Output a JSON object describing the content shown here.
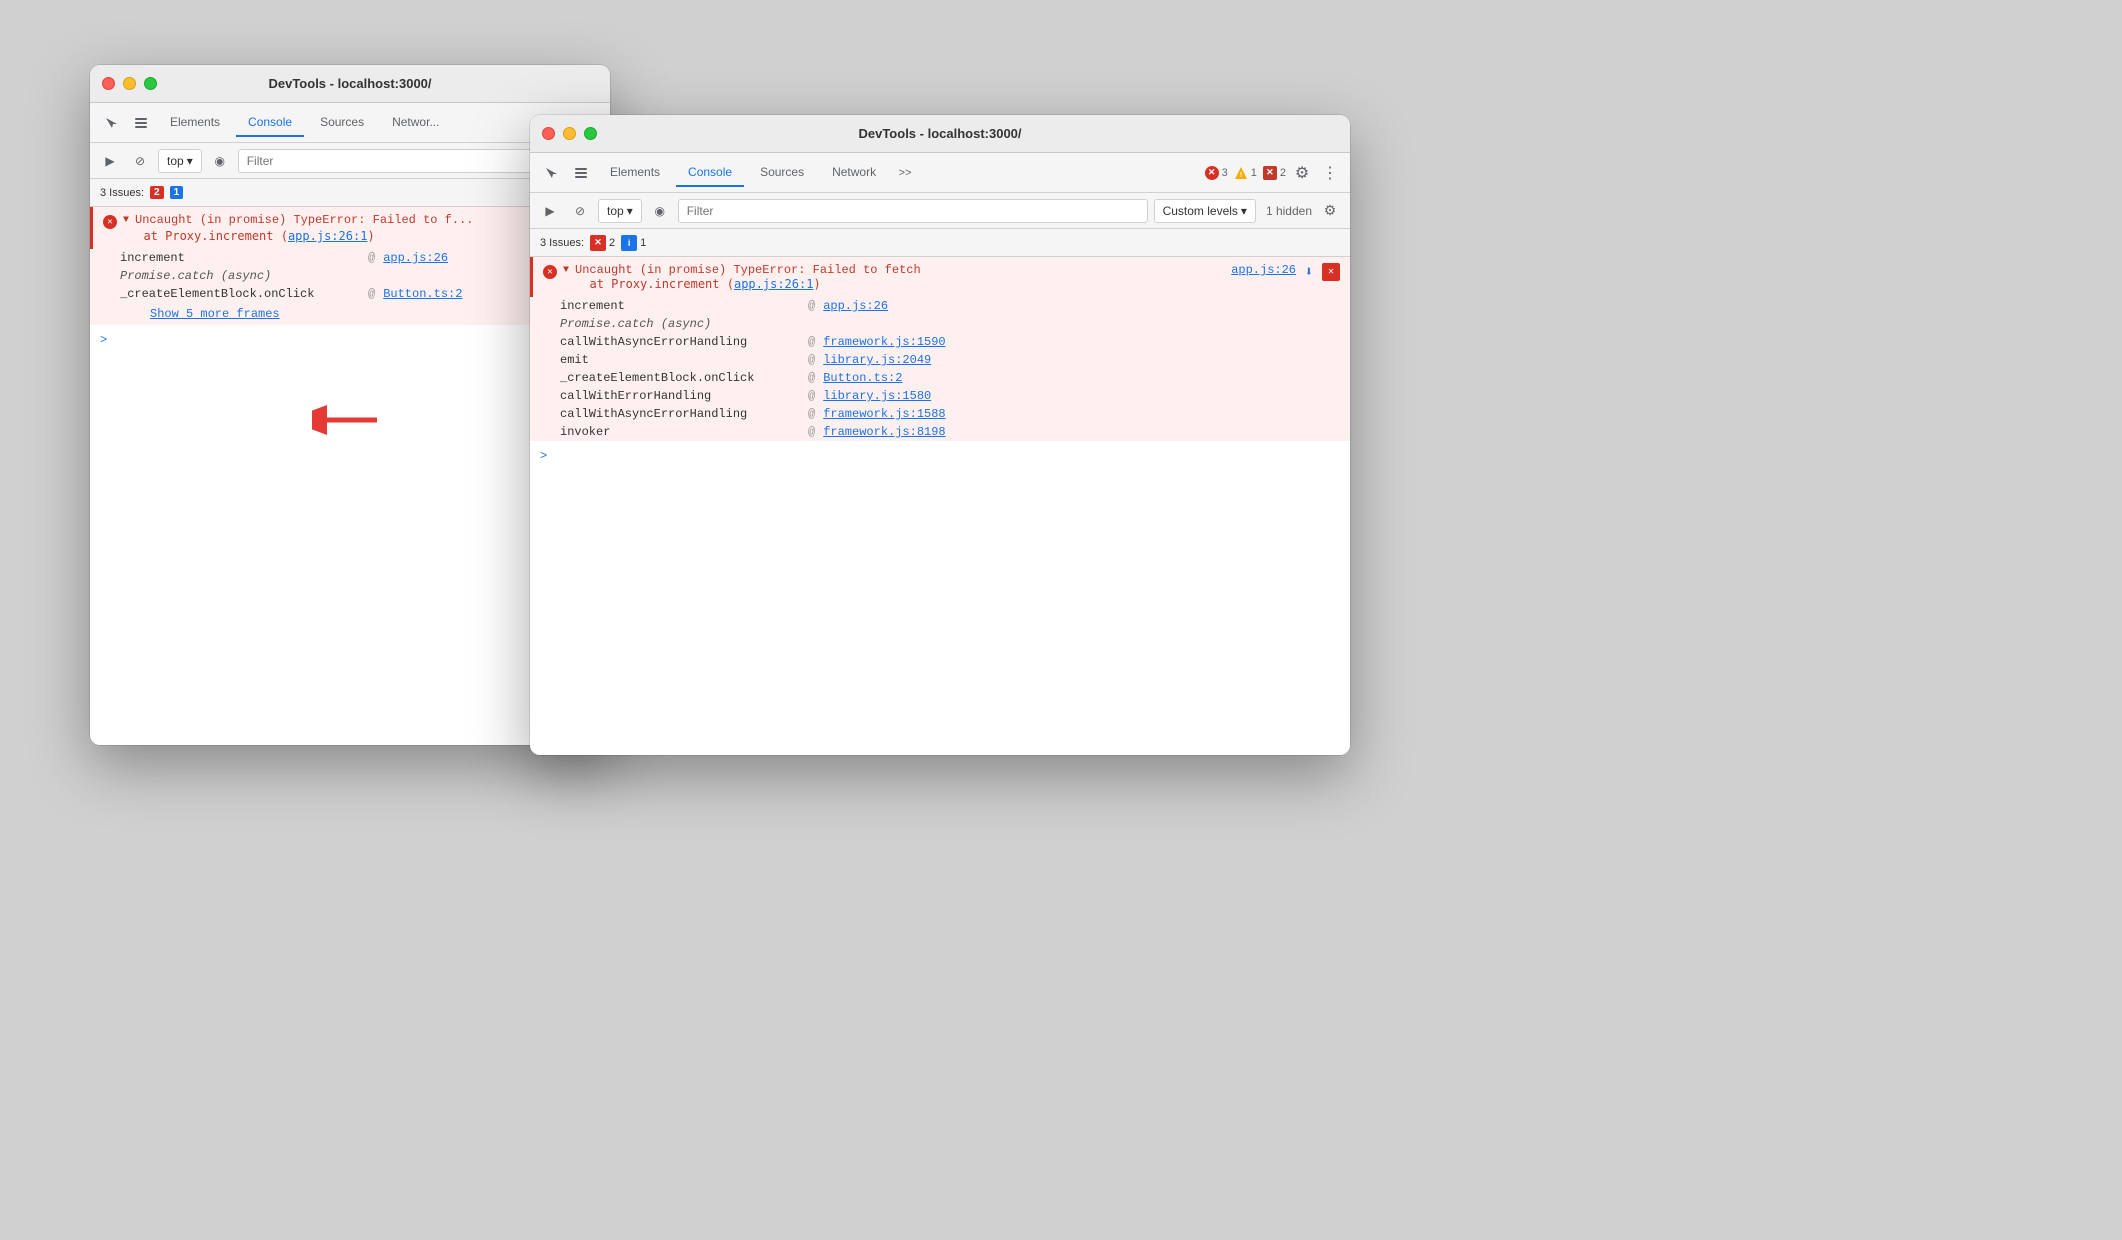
{
  "window1": {
    "title": "DevTools - localhost:3000/",
    "tabs": [
      {
        "label": "Elements",
        "active": false
      },
      {
        "label": "Console",
        "active": true
      },
      {
        "label": "Sources",
        "active": false
      },
      {
        "label": "Networ...",
        "active": false
      }
    ],
    "console_toolbar": {
      "top_label": "top",
      "filter_placeholder": "Filter"
    },
    "issues_bar": {
      "label": "3 Issues:",
      "error_count": "2",
      "info_count": "1"
    },
    "error": {
      "message": "▼ Uncaught (in promise) TypeError: Failed to f...",
      "at_proxy": "at Proxy.increment (",
      "proxy_link": "app.js:26:1",
      "stack": [
        {
          "fn": "increment",
          "at": "@",
          "link": "app.js:26"
        },
        {
          "fn": "Promise.catch (async)",
          "at": "",
          "link": ""
        },
        {
          "fn": "_createElementBlock.onClick",
          "at": "@",
          "link": "Button.ts:2"
        }
      ],
      "show_more": "Show 5 more frames"
    }
  },
  "window2": {
    "title": "DevTools - localhost:3000/",
    "tabs": [
      {
        "label": "Elements",
        "active": false
      },
      {
        "label": "Console",
        "active": true
      },
      {
        "label": "Sources",
        "active": false
      },
      {
        "label": "Network",
        "active": false
      }
    ],
    "badge_error": "3",
    "badge_warn": "1",
    "badge_error2": "2",
    "console_toolbar": {
      "top_label": "top",
      "filter_placeholder": "Filter",
      "custom_levels": "Custom levels",
      "hidden": "1 hidden"
    },
    "issues_bar": {
      "label": "3 Issues:",
      "error_count": "2",
      "info_count": "1"
    },
    "error": {
      "message": "Uncaught (in promise) TypeError: Failed to fetch",
      "at_proxy": "at Proxy.increment (",
      "proxy_link": "app.js:26:1",
      "file_link": "app.js:26",
      "stack": [
        {
          "fn": "increment",
          "at": "@",
          "link": "app.js:26"
        },
        {
          "fn": "Promise.catch (async)",
          "at": "",
          "link": "",
          "italic": true
        },
        {
          "fn": "callWithAsyncErrorHandling",
          "at": "@",
          "link": "framework.js:1590"
        },
        {
          "fn": "emit",
          "at": "@",
          "link": "library.js:2049"
        },
        {
          "fn": "_createElementBlock.onClick",
          "at": "@",
          "link": "Button.ts:2"
        },
        {
          "fn": "callWithErrorHandling",
          "at": "@",
          "link": "library.js:1580"
        },
        {
          "fn": "callWithAsyncErrorHandling",
          "at": "@",
          "link": "framework.js:1588"
        },
        {
          "fn": "invoker",
          "at": "@",
          "link": "framework.js:8198"
        }
      ]
    }
  },
  "icons": {
    "cursor": "⬡",
    "layers": "⬡",
    "play": "▶",
    "block": "⊘",
    "eye": "◉",
    "chevron_down": "▾",
    "gear": "⚙",
    "more": "⋮",
    "download": "⬇",
    "close_x": "✕",
    "more_tabs": ">>"
  }
}
